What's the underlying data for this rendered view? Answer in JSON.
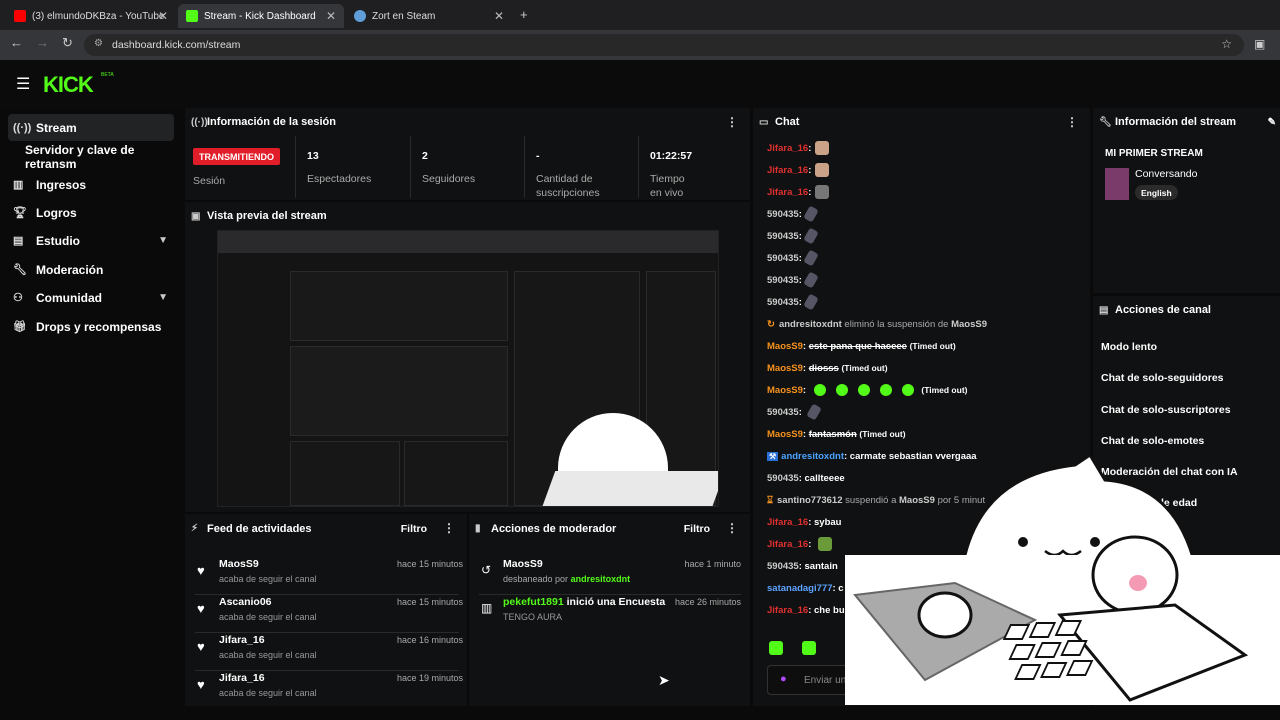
{
  "browser": {
    "tabs": [
      {
        "label": "(3) elmundoDKBza - YouTube",
        "color": "#ff0000"
      },
      {
        "label": "Stream - Kick Dashboard",
        "color": "#53fc18"
      },
      {
        "label": "Zort en Steam",
        "color": "#1b2838"
      }
    ],
    "new_tab": "+",
    "url": "dashboard.kick.com/stream"
  },
  "brand": {
    "logo": "KICK",
    "beta": "BETA",
    "accent": "#53fc18"
  },
  "sidebar": {
    "items": [
      {
        "label": "Stream",
        "icon": "broadcast-icon"
      },
      {
        "label": "Servidor y clave de retransm"
      },
      {
        "label": "Ingresos",
        "icon": "chart-icon"
      },
      {
        "label": "Logros",
        "icon": "trophy-icon"
      },
      {
        "label": "Estudio",
        "icon": "studio-icon"
      },
      {
        "label": "Moderación",
        "icon": "wrench-icon"
      },
      {
        "label": "Comunidad",
        "icon": "community-icon"
      },
      {
        "label": "Drops y recompensas",
        "icon": "gift-icon"
      }
    ]
  },
  "session": {
    "title": "Información de la sesión",
    "badge": "TRANSMITIENDO",
    "badge_label": "Sesión",
    "stats": [
      {
        "value": "13",
        "label": "Espectadores"
      },
      {
        "value": "2",
        "label": "Seguidores"
      },
      {
        "value": "-",
        "label": "Cantidad de suscripciones"
      },
      {
        "value": "01:22:57",
        "label": "Tiempo en vivo"
      }
    ]
  },
  "preview": {
    "title": "Vista previa del stream"
  },
  "feed": {
    "title": "Feed de actividades",
    "filter": "Filtro",
    "items": [
      {
        "name": "MaosS9",
        "sub": "acaba de seguir el canal",
        "time": "hace 15 minutos"
      },
      {
        "name": "Ascanio06",
        "sub": "acaba de seguir el canal",
        "time": "hace 15 minutos"
      },
      {
        "name": "Jifara_16",
        "sub": "acaba de seguir el canal",
        "time": "hace 16 minutos"
      },
      {
        "name": "Jifara_16",
        "sub": "acaba de seguir el canal",
        "time": "hace 19 minutos"
      }
    ]
  },
  "modactions": {
    "title": "Acciones de moderador",
    "filter": "Filtro",
    "items": [
      {
        "name": "MaosS9",
        "sub_prefix": "desbaneado por",
        "sub_user": "andresitoxdnt",
        "time": "hace 1 minuto"
      },
      {
        "name": "pekefut1891",
        "action": "inició una Encuesta",
        "sub": "TENGO AURA",
        "time": "hace 26 minutos"
      }
    ]
  },
  "chat": {
    "title": "Chat",
    "lines": [
      {
        "user": "Jifara_16",
        "text": "",
        "color": "#e03030"
      },
      {
        "user": "Jifara_16",
        "text": "",
        "color": "#e03030"
      },
      {
        "user": "Jifara_16",
        "text": "",
        "color": "#e03030"
      },
      {
        "user": "590435",
        "text": "",
        "color": "#cccccc"
      },
      {
        "user": "590435",
        "text": "",
        "color": "#cccccc"
      },
      {
        "user": "590435",
        "text": "",
        "color": "#cccccc"
      },
      {
        "user": "590435",
        "text": "",
        "color": "#cccccc"
      },
      {
        "user": "590435",
        "text": "",
        "color": "#cccccc"
      }
    ],
    "system1": {
      "user": "andresitoxdnt",
      "action": "eliminó la suspensión de",
      "target": "MaosS9"
    },
    "lines2": [
      {
        "user": "MaosS9",
        "text": "este pana que haceee",
        "note": "(Timed out)",
        "color": "#f7931e"
      },
      {
        "user": "MaosS9",
        "text": "diosss",
        "note": "(Timed out)",
        "color": "#f7931e"
      },
      {
        "user": "MaosS9",
        "text": "",
        "note": "(Timed out)",
        "color": "#f7931e"
      },
      {
        "user": "590435",
        "text": "",
        "note": "",
        "color": "#cccccc"
      },
      {
        "user": "MaosS9",
        "text": "fantasmón",
        "note": "(Timed out)",
        "color": "#f7931e"
      },
      {
        "user": "andresitoxdnt",
        "text": "carmate sebastian vvergaaa",
        "note": "",
        "color": "#4aa3ff"
      },
      {
        "user": "590435",
        "text": "callteeee",
        "note": "",
        "color": "#cccccc"
      }
    ],
    "system2": {
      "user": "santino773612",
      "action": "suspendió a",
      "target": "MaosS9",
      "tail": "por 5 minut"
    },
    "lines3": [
      {
        "user": "Jifara_16",
        "text": "sybau",
        "color": "#e03030"
      },
      {
        "user": "Jifara_16",
        "text": "",
        "color": "#e03030"
      },
      {
        "user": "590435",
        "text": "santain",
        "color": "#cccccc"
      },
      {
        "user": "satanadagi777",
        "text": "c",
        "color": "#5da3ff"
      },
      {
        "user": "Jifara_16",
        "text": "che bue",
        "color": "#e03030"
      }
    ],
    "input_placeholder": "Enviar un"
  },
  "streaminfo": {
    "title": "Información del stream",
    "stream_title": "MI PRIMER STREAM",
    "category": "Conversando",
    "tag": "English"
  },
  "channelactions": {
    "title": "Acciones de canal",
    "items": [
      "Modo lento",
      "Chat de solo-seguidores",
      "Chat de solo-suscriptores",
      "Chat de solo-emotes",
      "Moderación del chat con IA",
      "ción de edad"
    ]
  }
}
